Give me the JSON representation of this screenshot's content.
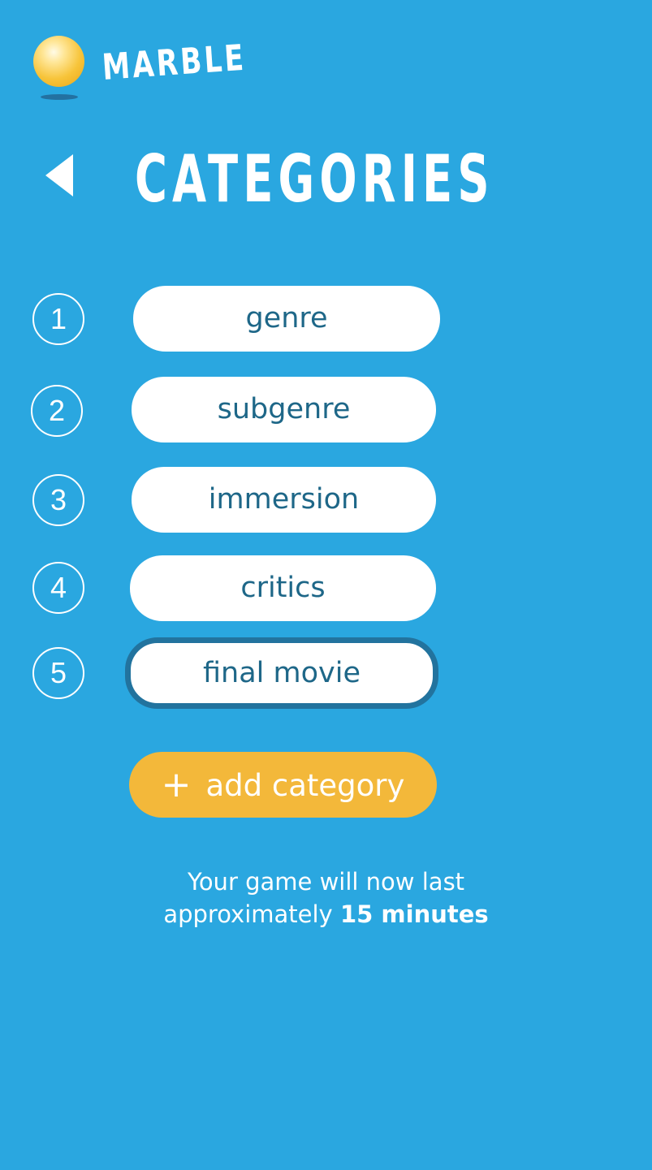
{
  "app": {
    "name": "MARBLE"
  },
  "page": {
    "title": "CATEGORIES"
  },
  "categories": [
    {
      "number": "1",
      "label": "genre"
    },
    {
      "number": "2",
      "label": "subgenre"
    },
    {
      "number": "3",
      "label": "immersion"
    },
    {
      "number": "4",
      "label": "critics"
    },
    {
      "number": "5",
      "label": "final movie",
      "selected": true
    }
  ],
  "add_button": {
    "icon": "+",
    "label": "add category"
  },
  "info": {
    "line1": "Your game will now last",
    "line2_prefix": "approximately",
    "line2_strong": "15 minutes"
  },
  "colors": {
    "background": "#2aa7e0",
    "pill_text": "#1e6788",
    "selected_border": "#22739e",
    "accent": "#f3b83a"
  }
}
